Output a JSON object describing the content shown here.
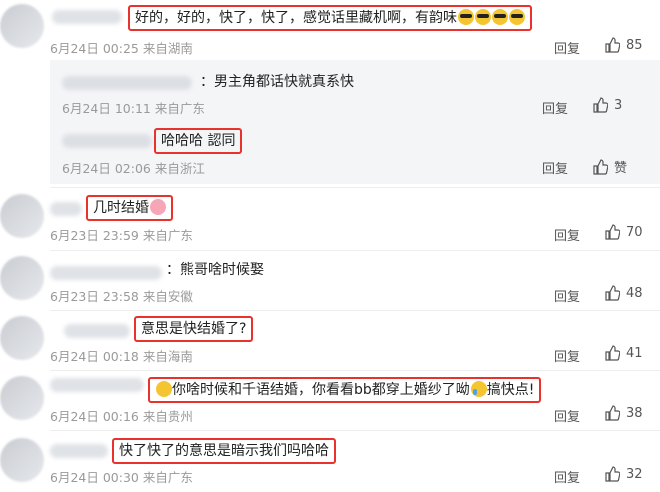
{
  "actions": {
    "reply_label": "回复"
  },
  "comments": [
    {
      "text": "好的，好的，快了，快了，感觉话里藏机啊，有韵味",
      "date": "6月24日 00:25 来自湖南",
      "likes": "85",
      "emoji_icon": "sunglasses-emoji"
    },
    {
      "text": "几时结婚",
      "date": "6月23日 23:59 来自广东",
      "likes": "70",
      "emoji_icon": "blush-emoji"
    },
    {
      "text": "：熊哥啥时候娶",
      "date": "6月23日 23:58 来自安徽",
      "likes": "48"
    },
    {
      "text": "意思是快结婚了?",
      "date": "6月24日 00:18 来自海南",
      "likes": "41"
    },
    {
      "text_part1": "你啥时候和千语结婚，你看看bb都穿上婚纱了呦",
      "text_part2": "搞快点!",
      "date": "6月24日 00:16 来自贵州",
      "likes": "38"
    },
    {
      "text": "快了快了的意思是暗示我们吗哈哈",
      "date": "6月24日 00:30 来自广东",
      "likes": "32"
    }
  ],
  "replies": [
    {
      "text": "：男主角都话快就真系快",
      "date": "6月24日 10:11 来自广东",
      "likes": "3"
    },
    {
      "text": "哈哈哈 認同",
      "date": "6月24日 02:06 来自浙江",
      "likes": "赞"
    }
  ]
}
